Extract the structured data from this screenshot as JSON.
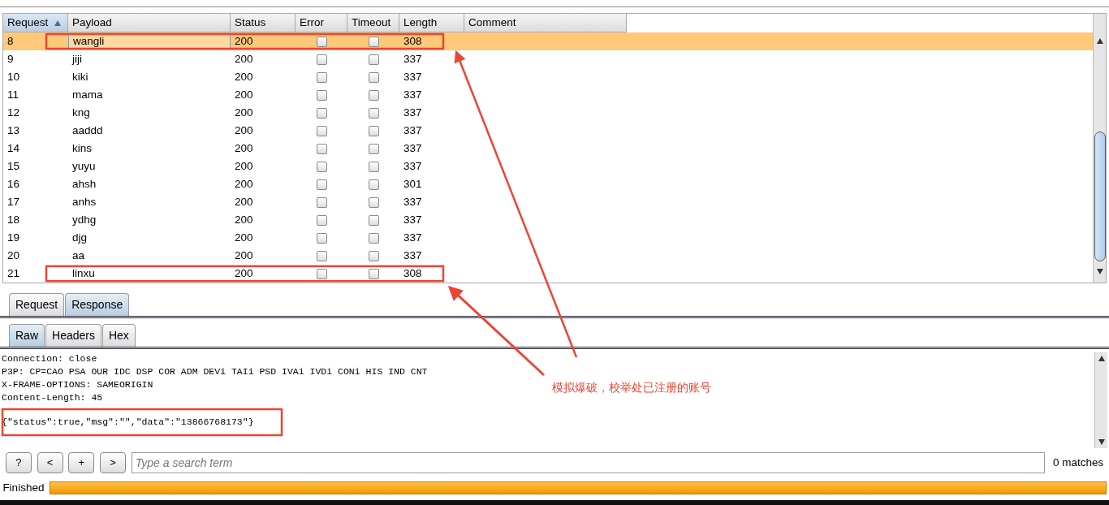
{
  "table": {
    "columns": [
      {
        "label": "Request",
        "sorted": true
      },
      {
        "label": "Payload",
        "sorted": false
      },
      {
        "label": "Status",
        "sorted": false
      },
      {
        "label": "Error",
        "sorted": false
      },
      {
        "label": "Timeout",
        "sorted": false
      },
      {
        "label": "Length",
        "sorted": false
      },
      {
        "label": "Comment",
        "sorted": false
      }
    ],
    "rows": [
      {
        "request": "8",
        "payload": "wangli",
        "status": "200",
        "error": false,
        "timeout": false,
        "length": "308",
        "selected": true
      },
      {
        "request": "9",
        "payload": "jiji",
        "status": "200",
        "error": false,
        "timeout": false,
        "length": "337",
        "selected": false
      },
      {
        "request": "10",
        "payload": "kiki",
        "status": "200",
        "error": false,
        "timeout": false,
        "length": "337",
        "selected": false
      },
      {
        "request": "11",
        "payload": "mama",
        "status": "200",
        "error": false,
        "timeout": false,
        "length": "337",
        "selected": false
      },
      {
        "request": "12",
        "payload": "kng",
        "status": "200",
        "error": false,
        "timeout": false,
        "length": "337",
        "selected": false
      },
      {
        "request": "13",
        "payload": "aaddd",
        "status": "200",
        "error": false,
        "timeout": false,
        "length": "337",
        "selected": false
      },
      {
        "request": "14",
        "payload": "kins",
        "status": "200",
        "error": false,
        "timeout": false,
        "length": "337",
        "selected": false
      },
      {
        "request": "15",
        "payload": "yuyu",
        "status": "200",
        "error": false,
        "timeout": false,
        "length": "337",
        "selected": false
      },
      {
        "request": "16",
        "payload": "ahsh",
        "status": "200",
        "error": false,
        "timeout": false,
        "length": "301",
        "selected": false
      },
      {
        "request": "17",
        "payload": "anhs",
        "status": "200",
        "error": false,
        "timeout": false,
        "length": "337",
        "selected": false
      },
      {
        "request": "18",
        "payload": "ydhg",
        "status": "200",
        "error": false,
        "timeout": false,
        "length": "337",
        "selected": false
      },
      {
        "request": "19",
        "payload": "djg",
        "status": "200",
        "error": false,
        "timeout": false,
        "length": "337",
        "selected": false
      },
      {
        "request": "20",
        "payload": "aa",
        "status": "200",
        "error": false,
        "timeout": false,
        "length": "337",
        "selected": false
      },
      {
        "request": "21",
        "payload": "linxu",
        "status": "200",
        "error": false,
        "timeout": false,
        "length": "308",
        "selected": false
      }
    ]
  },
  "message_tabs": [
    {
      "label": "Request",
      "selected": false
    },
    {
      "label": "Response",
      "selected": true
    }
  ],
  "view_tabs": [
    {
      "label": "Raw",
      "selected": true
    },
    {
      "label": "Headers",
      "selected": false
    },
    {
      "label": "Hex",
      "selected": false
    }
  ],
  "response_headers": [
    "Connection: close",
    "P3P: CP=CAO PSA OUR IDC DSP COR ADM DEVi TAIi PSD IVAi IVDi CONi HIS IND CNT",
    "X-FRAME-OPTIONS: SAMEORIGIN",
    "Content-Length: 45"
  ],
  "response_body": "{\"status\":true,\"msg\":\"\",\"data\":\"13866768173\"}",
  "search_bar": {
    "buttons": [
      "?",
      "<",
      "+",
      ">"
    ],
    "placeholder": "Type a search term",
    "matches": "0 matches"
  },
  "status_bar": {
    "label": "Finished",
    "level": 1
  },
  "annotation": {
    "text": "模拟爆破，校举处已注册的账号"
  }
}
